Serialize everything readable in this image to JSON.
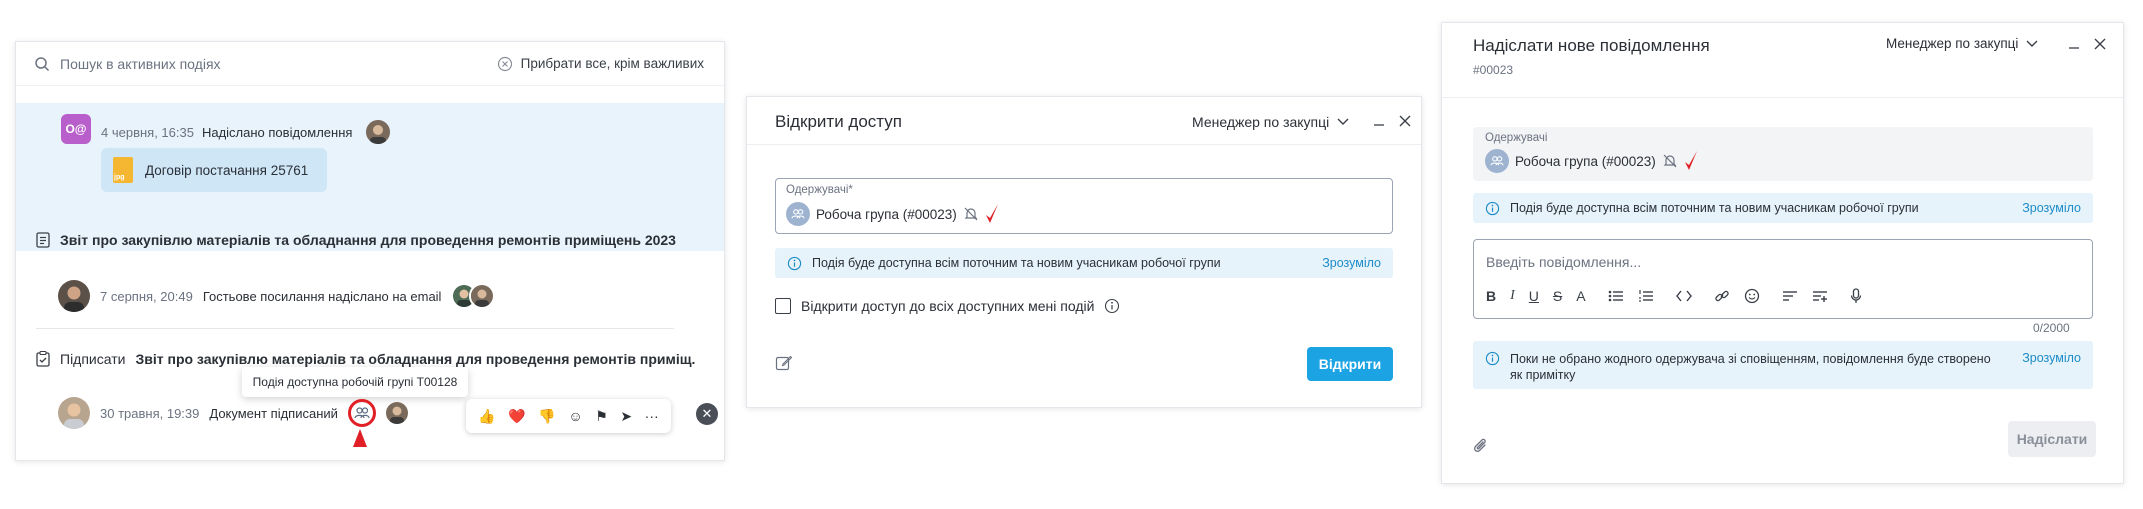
{
  "feed": {
    "search_placeholder": "Пошук в активних подіях",
    "clear_label": "Прибрати все, крім важливих",
    "events": [
      {
        "badge": "O@",
        "time": "4 червня, 16:35",
        "text": "Надіслано повідомлення",
        "attachment": "Договір постачання 25761"
      },
      {
        "title": "Звіт про закупівлю матеріалів та обладнання для проведення ремонтів приміщень 2023",
        "time": "7 серпня, 20:49",
        "text": "Гостьове посилання надіслано на email"
      },
      {
        "title_prefix": "Підписати",
        "title": "Звіт про закупівлю матеріалів та обладнання для проведення ремонтів приміщ...",
        "time": "30 травня, 19:39",
        "text": "Документ підписаний"
      }
    ],
    "tooltip": "Подія доступна робочій групі T00128",
    "reactions": [
      "👍",
      "❤️",
      "👎",
      "☺",
      "⚑",
      "➤",
      "···"
    ],
    "close_glyph": "✕"
  },
  "access_dialog": {
    "title": "Відкрити доступ",
    "role": "Менеджер по закупці",
    "recipients_label": "Одержувачі*",
    "recipient": "Робоча група (#00023)",
    "info_text": "Подія буде доступна всім поточним та новим учасникам робочої групи",
    "info_ok": "Зрозуміло",
    "checkbox_label": "Відкрити доступ до всіх доступних мені подій",
    "submit": "Відкрити"
  },
  "message_dialog": {
    "title": "Надіслати нове повідомлення",
    "id": "#00023",
    "role": "Менеджер по закупці",
    "recipients_label": "Одержувачі",
    "recipient": "Робоча група (#00023)",
    "info_text": "Подія буде доступна всім поточним та новим учасникам робочої групи",
    "info_ok": "Зрозуміло",
    "editor_placeholder": "Введіть повідомлення...",
    "counter": "0/2000",
    "note_line1": "Поки не обрано жодного одержувача зі сповіщенням, повідомлення буде створено",
    "note_line2": "як примітку",
    "note_ok": "Зрозуміло",
    "submit": "Надіслати"
  },
  "colors": {
    "accent": "#1ba3e4",
    "link": "#1d8cc8",
    "highlight_row": "#e8f3fb",
    "info_bg": "#e6f3fb",
    "annotation_red": "#e01f26",
    "badge_purple": "#b85fcb"
  }
}
